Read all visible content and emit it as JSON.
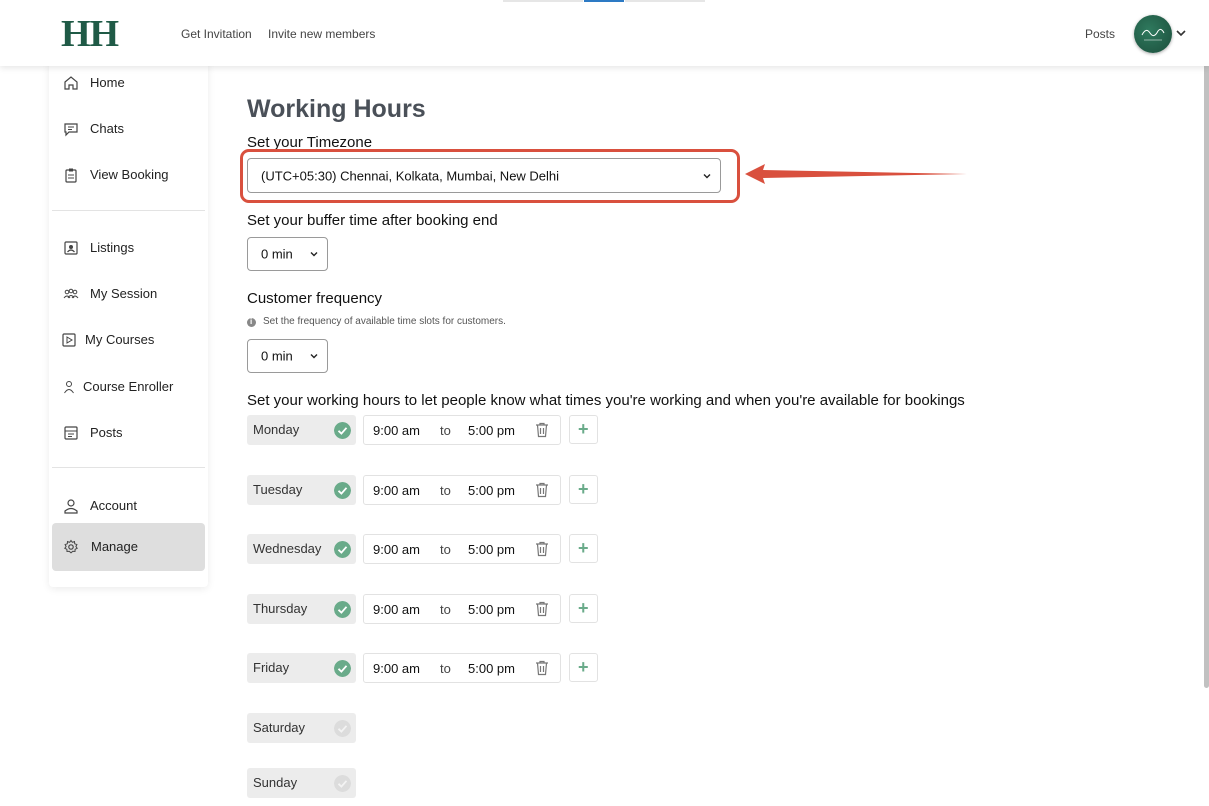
{
  "header": {
    "logo": "HH",
    "links": [
      "Get Invitation",
      "Invite new members"
    ],
    "posts_link": "Posts"
  },
  "sidebar": {
    "items": [
      {
        "label": "Home",
        "icon": "home-icon"
      },
      {
        "label": "Chats",
        "icon": "chat-icon"
      },
      {
        "label": "View Booking",
        "icon": "clipboard-icon"
      },
      {
        "label": "Listings",
        "icon": "listing-icon"
      },
      {
        "label": "My Session",
        "icon": "people-icon"
      },
      {
        "label": "My Courses",
        "icon": "play-icon"
      },
      {
        "label": "Course Enroller",
        "icon": "user-icon"
      },
      {
        "label": "Posts",
        "icon": "posts-icon"
      },
      {
        "label": "Account",
        "icon": "account-icon"
      },
      {
        "label": "Manage",
        "icon": "gear-icon",
        "active": true
      }
    ]
  },
  "main": {
    "title": "Working Hours",
    "timezone_label": "Set your Timezone",
    "timezone_value": "(UTC+05:30) Chennai, Kolkata, Mumbai, New Delhi",
    "buffer_label": "Set your buffer time after booking end",
    "buffer_value": "0 min",
    "frequency_label": "Customer frequency",
    "frequency_hint": "Set the frequency of available time slots for customers.",
    "frequency_value": "0 min",
    "hours_label": "Set your working hours to let people know what times you're working and when you're available for bookings",
    "to_label": "to",
    "days": [
      {
        "name": "Monday",
        "enabled": true,
        "start": "9:00 am",
        "end": "5:00 pm"
      },
      {
        "name": "Tuesday",
        "enabled": true,
        "start": "9:00 am",
        "end": "5:00 pm"
      },
      {
        "name": "Wednesday",
        "enabled": true,
        "start": "9:00 am",
        "end": "5:00 pm"
      },
      {
        "name": "Thursday",
        "enabled": true,
        "start": "9:00 am",
        "end": "5:00 pm"
      },
      {
        "name": "Friday",
        "enabled": true,
        "start": "9:00 am",
        "end": "5:00 pm"
      },
      {
        "name": "Saturday",
        "enabled": false
      },
      {
        "name": "Sunday",
        "enabled": false
      }
    ]
  },
  "colors": {
    "brand": "#1f5a46",
    "check_active": "#6aab8a",
    "check_inactive": "#d6d6d6",
    "highlight": "#d9503e"
  }
}
